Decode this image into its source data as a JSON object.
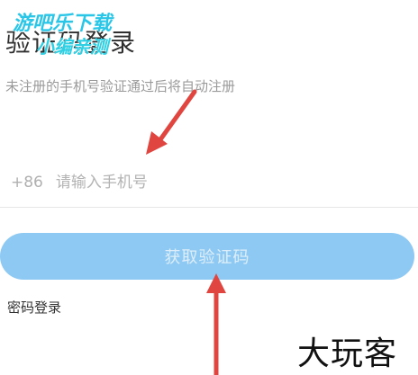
{
  "header": {
    "title": "验证码登录",
    "subtitle": "未注册的手机号验证通过后将自动注册"
  },
  "phone": {
    "country_code": "+86",
    "placeholder": "请输入手机号",
    "value": ""
  },
  "actions": {
    "get_code_label": "获取验证码",
    "password_login_label": "密码登录"
  },
  "watermarks": {
    "top_line1": "游吧乐下载",
    "top_line2": "小编亲测",
    "bottom": "大玩客"
  },
  "colors": {
    "button_bg": "#8ec9f3",
    "button_text": "#ddeefa",
    "annotation_arrow": "#e0463f",
    "watermark_top": "#29c6e8"
  },
  "icons": {
    "annotation": "red-arrow"
  }
}
